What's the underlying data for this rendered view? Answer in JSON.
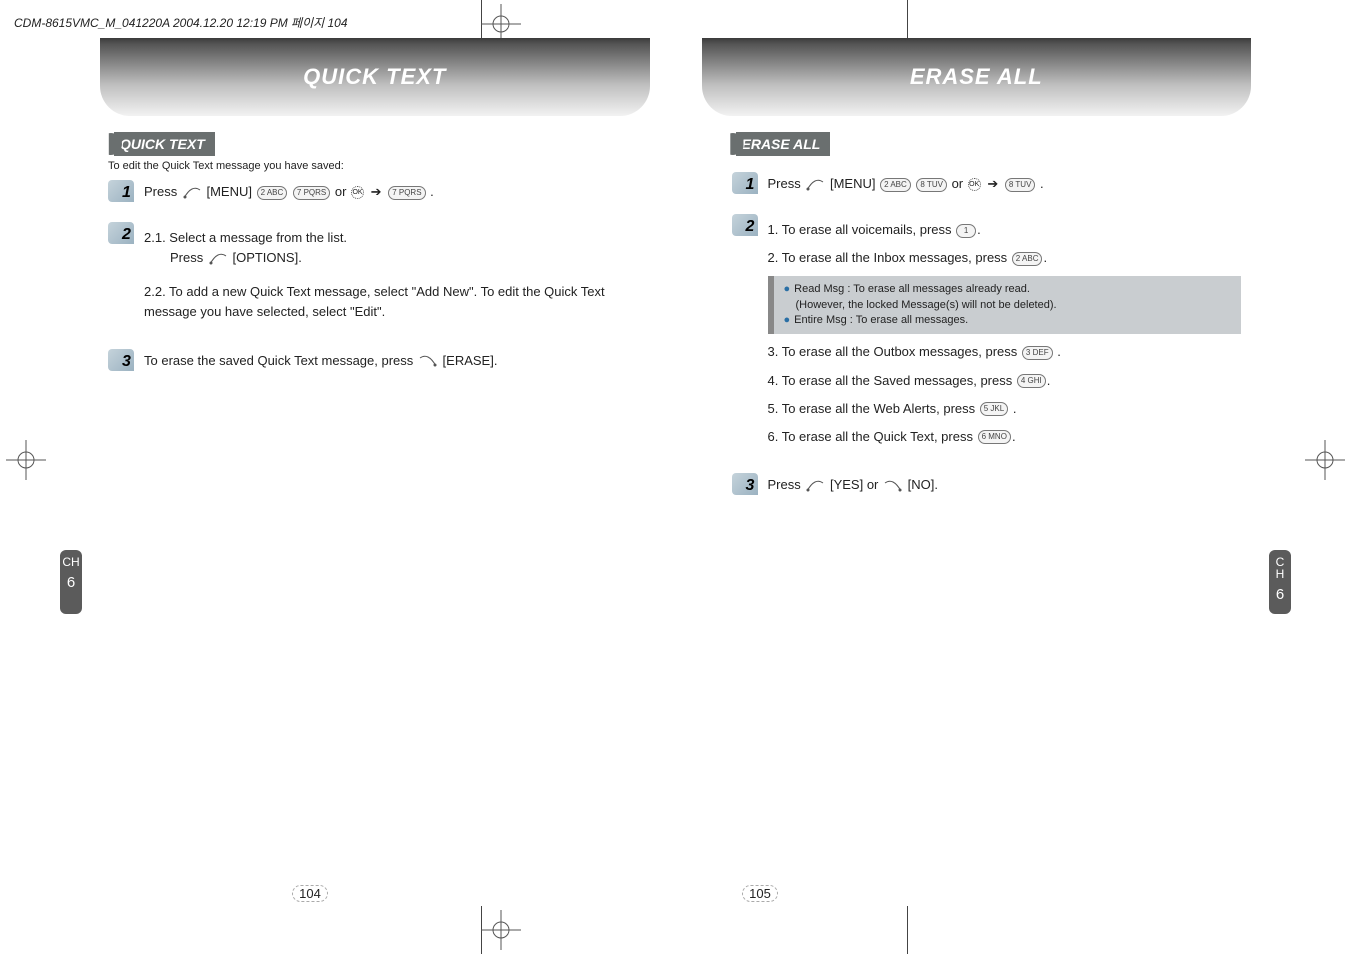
{
  "doc_header": "CDM-8615VMC_M_041220A  2004.12.20 12:19 PM  페이지 104",
  "left": {
    "banner": "QUICK TEXT",
    "sub_heading": "QUICK TEXT",
    "intro": "To edit the Quick Text message you have saved:",
    "step1": {
      "prefix": "Press ",
      "menu": " [MENU] ",
      "or": " or ",
      "dot": " ."
    },
    "step2": {
      "s21a": "2.1. Select a message from the list.",
      "s21b": "Press ",
      "s21c": " [OPTIONS].",
      "s22": "2.2. To add a new Quick Text message, select \"Add New\". To edit the Quick Text message you have selected, select \"Edit\"."
    },
    "step3": {
      "a": "To erase the saved Quick Text message, press ",
      "b": " [ERASE]."
    },
    "ch": "CH",
    "ch_num": "6",
    "page_num": "104"
  },
  "right": {
    "banner": "ERASE ALL",
    "sub_heading": "ERASE ALL",
    "step1": {
      "prefix": "Press ",
      "menu": " [MENU] ",
      "or": " or ",
      "dot": " ."
    },
    "step2": {
      "s1": "1. To erase all voicemails, press",
      "s2": "2. To erase all the Inbox messages, press",
      "note_read": "Read Msg : To erase all messages already read.",
      "note_locked": "(However, the locked Message(s) will not be deleted).",
      "note_entire": "Entire Msg : To erase all messages.",
      "s3": "3. To erase all the Outbox messages, press ",
      "s4": "4. To erase all the Saved messages, press",
      "s5": "5. To erase all the Web Alerts, press ",
      "s6": "6. To erase all the Quick Text, press",
      "dot": "."
    },
    "step3": {
      "a": "Press ",
      "b": " [YES] or ",
      "c": " [NO]."
    },
    "ch": "CH",
    "ch_num": "6",
    "page_num": "105"
  },
  "keys": {
    "k1": "1",
    "k2": "2 ABC",
    "k3": "3 DEF",
    "k4": "4 GHI",
    "k5": "5 JKL",
    "k6": "6 MNO",
    "k7": "7 PQRS",
    "k8": "8 TUV",
    "ok": "OK"
  }
}
